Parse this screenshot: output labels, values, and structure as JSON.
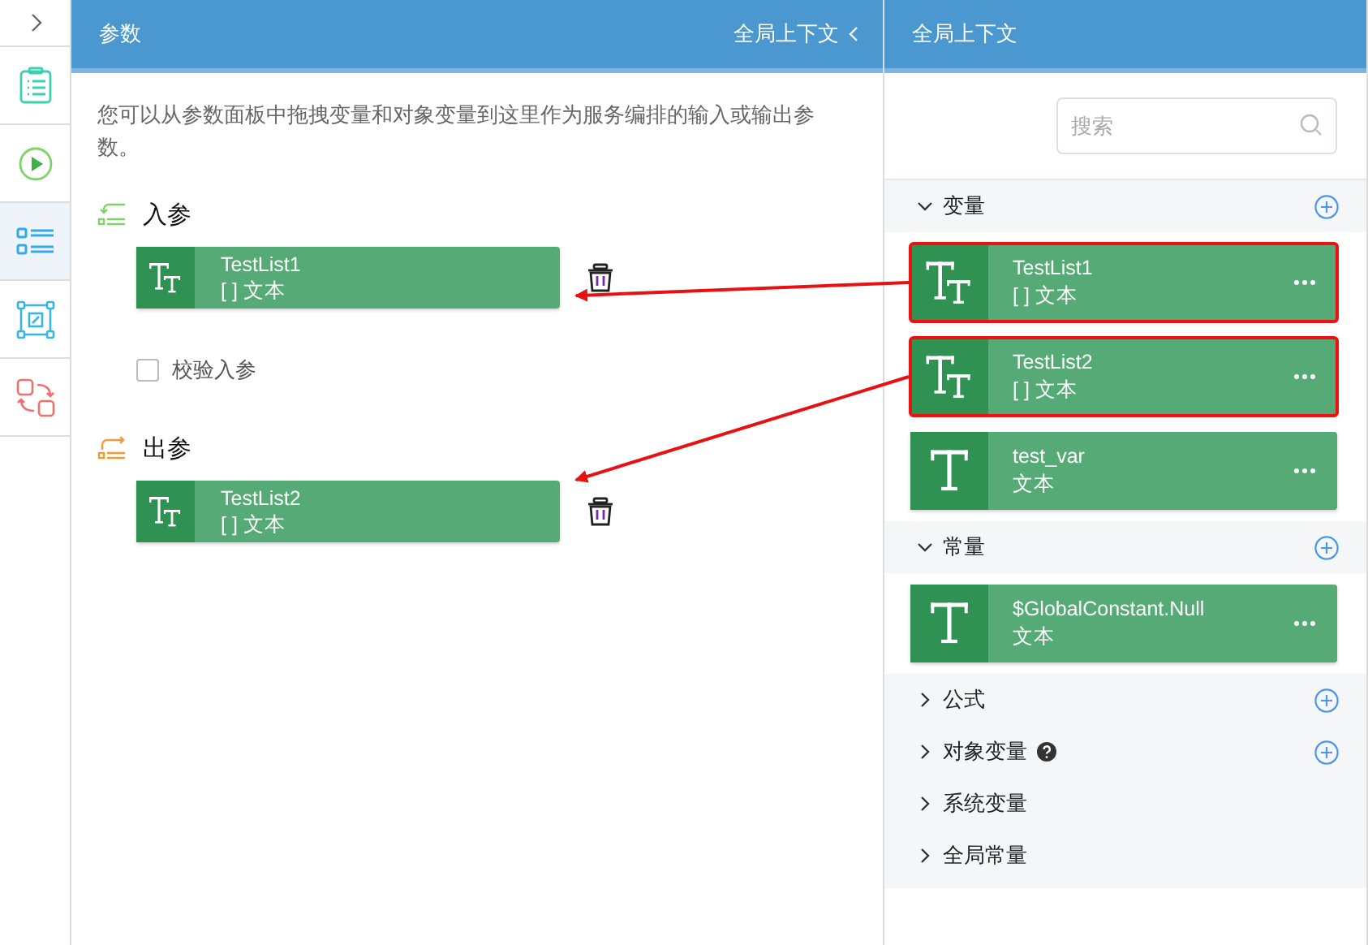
{
  "sidebar": {
    "items": [
      {
        "kind": "outline",
        "selected": false
      },
      {
        "kind": "run",
        "selected": false
      },
      {
        "kind": "params",
        "selected": true
      },
      {
        "kind": "mapping",
        "selected": false
      },
      {
        "kind": "convert",
        "selected": false
      }
    ]
  },
  "params": {
    "title": "参数",
    "context_link": "全局上下文",
    "description": "您可以从参数面板中拖拽变量和对象变量到这里作为服务编排的输入或输出参数。",
    "input": {
      "title": "入参",
      "params": [
        {
          "kind": "list",
          "name": "TestList1",
          "type": "[ ] 文本",
          "dropped": true
        }
      ],
      "validate": {
        "label": "校验入参",
        "checked": false
      }
    },
    "output": {
      "title": "出参",
      "params": [
        {
          "kind": "list",
          "name": "TestList2",
          "type": "[ ] 文本",
          "dropped": true
        }
      ]
    }
  },
  "context": {
    "title": "全局上下文",
    "search": {
      "placeholder": "搜索"
    },
    "sections": [
      {
        "name": "变量",
        "expanded": true,
        "addable": true,
        "help": false,
        "items": [
          {
            "kind": "list",
            "name": "TestList1",
            "type": "[ ] 文本",
            "highlighted": true
          },
          {
            "kind": "list",
            "name": "TestList2",
            "type": "[ ] 文本",
            "highlighted": true
          },
          {
            "kind": "text",
            "name": "test_var",
            "type": "文本",
            "highlighted": false
          }
        ]
      },
      {
        "name": "常量",
        "expanded": true,
        "addable": true,
        "help": false,
        "items": [
          {
            "kind": "text",
            "name": "$GlobalConstant.Null",
            "type": "文本",
            "highlighted": false
          }
        ]
      },
      {
        "name": "公式",
        "expanded": false,
        "addable": true,
        "help": false
      },
      {
        "name": "对象变量",
        "expanded": false,
        "addable": true,
        "help": true
      },
      {
        "name": "系统变量",
        "expanded": false,
        "addable": false,
        "help": false
      },
      {
        "name": "全局常量",
        "expanded": false,
        "addable": false,
        "help": false
      }
    ]
  }
}
